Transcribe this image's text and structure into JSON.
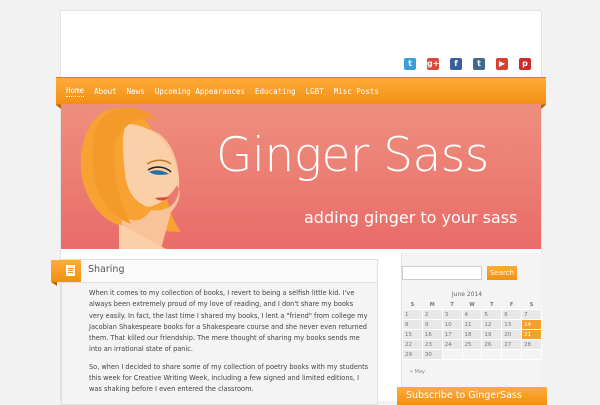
{
  "social": [
    {
      "name": "twitter",
      "glyph": "t",
      "color": "#3b9fd8"
    },
    {
      "name": "google-plus",
      "glyph": "g+",
      "color": "#d94a3a"
    },
    {
      "name": "facebook",
      "glyph": "f",
      "color": "#3b5ea0"
    },
    {
      "name": "tumblr",
      "glyph": "t",
      "color": "#3f6a8f"
    },
    {
      "name": "youtube",
      "glyph": "▶",
      "color": "#d8402f"
    },
    {
      "name": "pinterest",
      "glyph": "p",
      "color": "#cd2b2b"
    }
  ],
  "nav": [
    "Home",
    "About",
    "News",
    "Upcoming Appearances",
    "Educating",
    "LGBT",
    "Misc Posts"
  ],
  "banner": {
    "title": "Ginger Sass",
    "tagline": "adding ginger to your sass"
  },
  "post": {
    "title": "Sharing",
    "p1": "When it comes to my collection of books, I revert to being a selfish little kid. I've always been extremely proud of my love of reading, and I don't share my books very easily. In fact, the last time I shared my books, I lent a \"friend\" from college my Jacobian Shakespeare books for a Shakespeare course and she never even returned them. That killed our friendship. The mere thought of sharing my books sends me into an irrational state of panic.",
    "p2": "So, when I decided to share some of my collection of poetry books with my students this week for Creative Writing Week, including a few signed and limited editions, I was shaking before I even entered the classroom."
  },
  "search": {
    "placeholder": "",
    "button": "Search"
  },
  "calendar": {
    "caption": "June 2014",
    "days": [
      "S",
      "M",
      "T",
      "W",
      "T",
      "F",
      "S"
    ],
    "rows": [
      [
        "1",
        "2",
        "3",
        "4",
        "5",
        "6",
        "7"
      ],
      [
        "8",
        "9",
        "10",
        "11",
        "12",
        "13",
        "14"
      ],
      [
        "15",
        "16",
        "17",
        "18",
        "19",
        "20",
        "21"
      ],
      [
        "22",
        "23",
        "24",
        "25",
        "26",
        "27",
        "28"
      ],
      [
        "29",
        "30",
        "",
        "",
        "",
        "",
        ""
      ]
    ],
    "highlighted": [
      "14",
      "21"
    ],
    "prev": "« May"
  },
  "subscribe": "Subscribe to GingerSass"
}
